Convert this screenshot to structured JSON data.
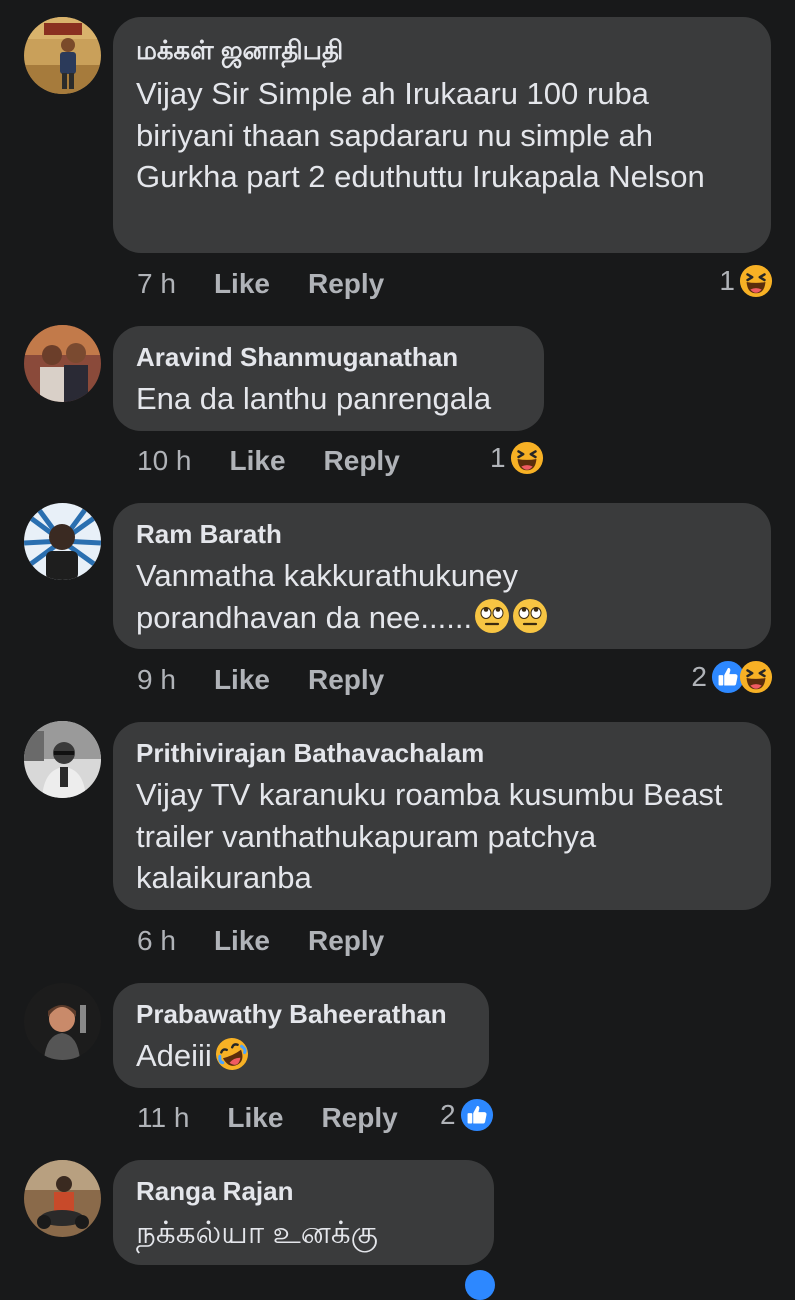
{
  "colors": {
    "background": "#18191a",
    "bubble": "#3a3b3c",
    "text_primary": "#e4e6eb",
    "text_secondary": "#b0b3b8",
    "like_blue": "#2d88ff",
    "haha_yellow": "#f7b125"
  },
  "actions": {
    "like": "Like",
    "reply": "Reply"
  },
  "comments": [
    {
      "author": "மக்கள் ஜனாதிபதி",
      "text": "Vijay Sir Simple ah Irukaaru 100 ruba biriyani thaan sapdararu nu simple ah Gurkha part 2 eduthuttu Irukapala Nelson",
      "time": "7 h",
      "reaction_count": "1",
      "reaction_icons": [
        "haha-icon"
      ]
    },
    {
      "author": "Aravind Shanmuganathan",
      "text": "Ena da lanthu panrengala",
      "time": "10 h",
      "reaction_count": "1",
      "reaction_icons": [
        "haha-icon"
      ]
    },
    {
      "author": "Ram Barath",
      "text": "Vanmatha kakkurathukuney porandhavan da nee......",
      "text_emojis": [
        "rolling-eyes-icon",
        "rolling-eyes-icon"
      ],
      "time": "9 h",
      "reaction_count": "2",
      "reaction_icons": [
        "like-icon",
        "haha-icon"
      ]
    },
    {
      "author": "Prithivirajan Bathavachalam",
      "text": "Vijay TV karanuku roamba kusumbu Beast trailer vanthathukapuram patchya kalaikuranba",
      "time": "6 h",
      "reaction_count": "",
      "reaction_icons": []
    },
    {
      "author": "Prabawathy Baheerathan",
      "text": "Adeiii",
      "text_emojis": [
        "rolling-laughing-icon"
      ],
      "time": "11 h",
      "reaction_count": "2",
      "reaction_icons": [
        "like-icon"
      ]
    },
    {
      "author": "Ranga Rajan",
      "text": "நக்கல்யா உனக்கு",
      "time": "",
      "reaction_count": "",
      "reaction_icons": []
    }
  ]
}
